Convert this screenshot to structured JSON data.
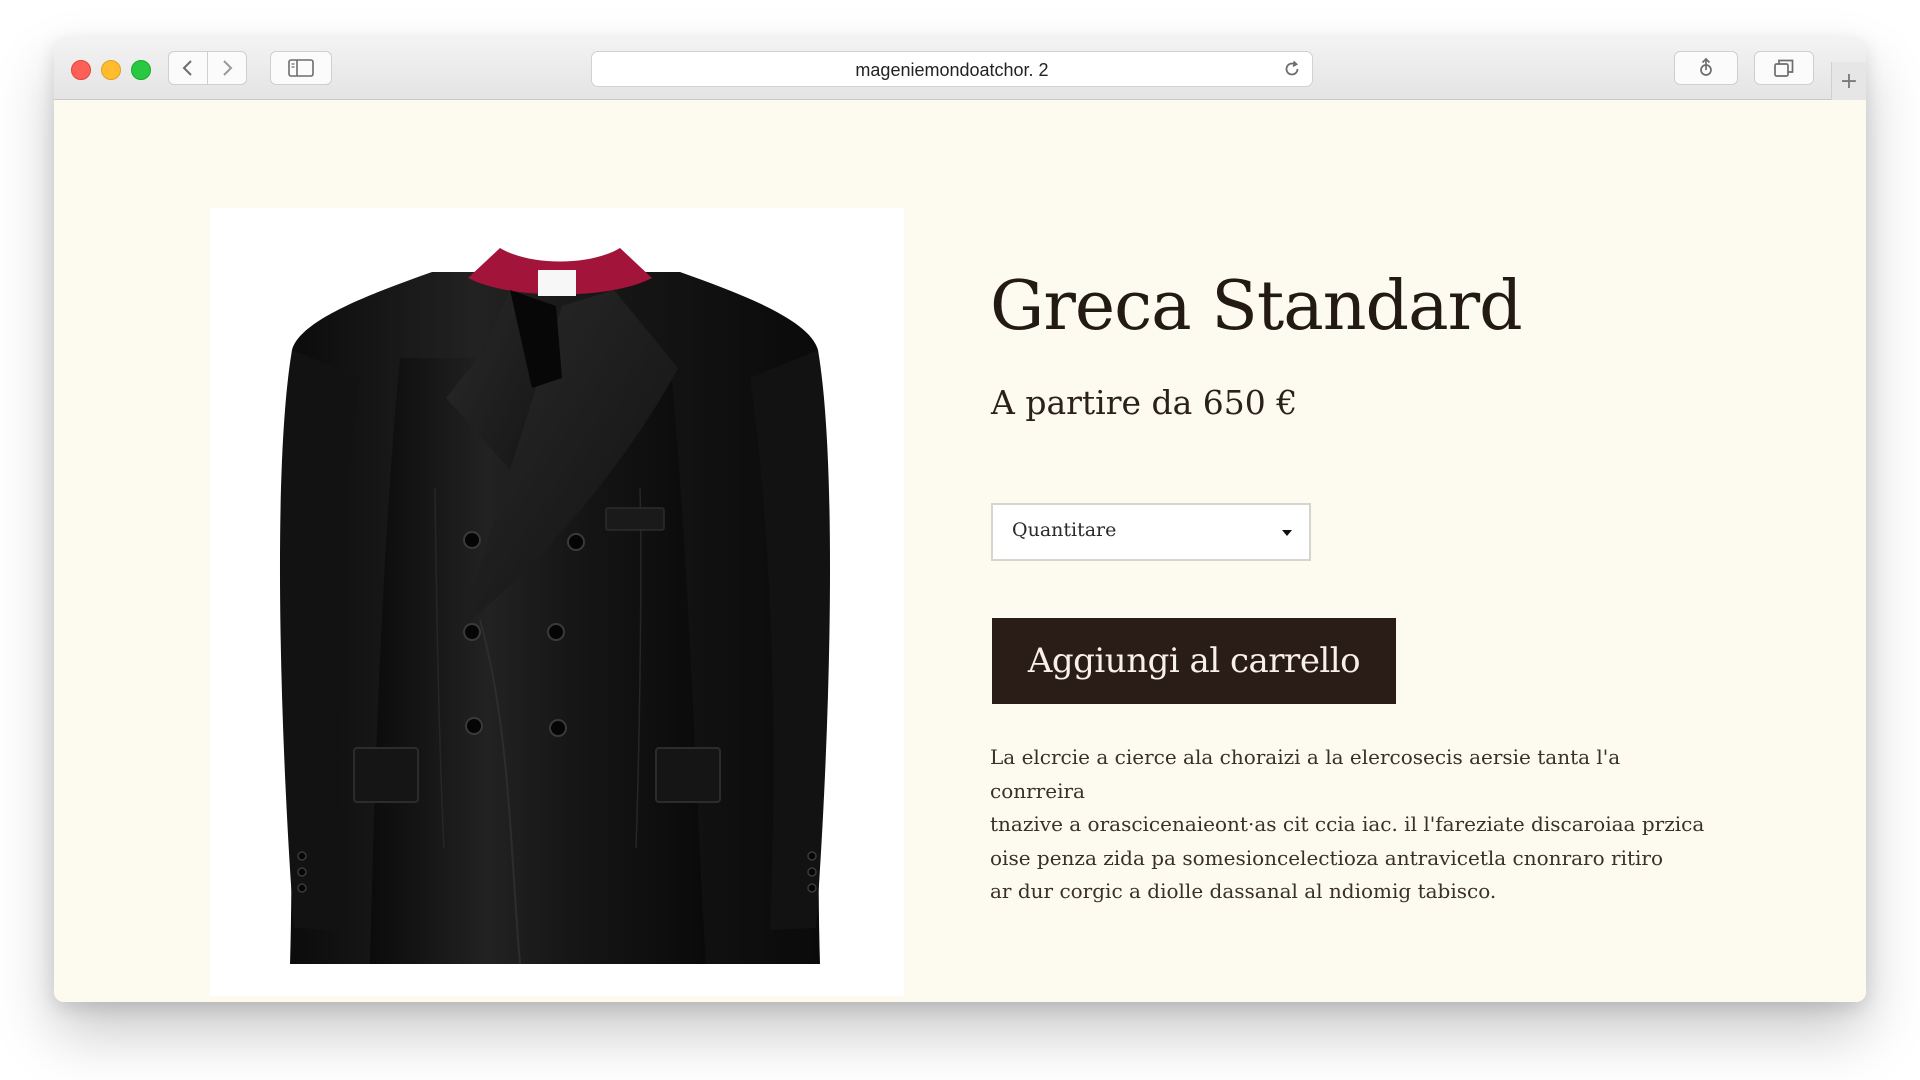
{
  "browser": {
    "url": "mageniemondoatchor. 2",
    "icons": {
      "close": "close-dot",
      "minimize": "minimize-dot",
      "zoom": "zoom-dot",
      "back": "chevron-left-icon",
      "forward": "chevron-right-icon",
      "sidebar": "sidebar-icon",
      "reload": "reload-icon",
      "share": "share-icon",
      "tabs": "tabs-overview-icon",
      "new_tab": "plus-icon"
    },
    "new_tab_label": "+"
  },
  "product": {
    "image_alt": "black double-breasted clerical coat with red collar",
    "title": "Greca Standard",
    "price": "A partire da 650 €",
    "quantity_select": {
      "label": "Quantitare",
      "caret_icon": "caret-down-icon"
    },
    "add_to_cart": "Aggiungi al carrello",
    "description": [
      "La elcrcie a cierce ala choraizi a la elercosecis aersie tanta l'a conrreira",
      "tnazive a orascicenaieont·as cit ccia iac. il l'fareziate discaroiaa przica",
      "oise penza zida pa somesioncelectioza antravicetla cnonraro ritiro",
      "ar dur corgic a diolle dassanal al ndiomig tabisco."
    ]
  },
  "colors": {
    "page_background": "#fdfbef",
    "button_background": "#2a1d17",
    "title_text": "#231a14",
    "collar_accent": "#a3143a"
  }
}
